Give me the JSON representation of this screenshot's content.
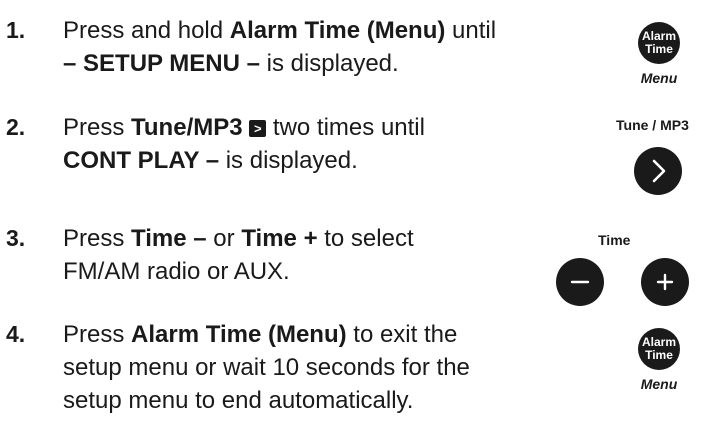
{
  "steps": [
    {
      "num": "1.",
      "parts": [
        "Press and hold ",
        "Alarm Time (Menu)",
        " until",
        "– SETUP MENU –",
        " is displayed."
      ]
    },
    {
      "num": "2.",
      "parts": [
        "Press ",
        "Tune/MP3",
        " two times until",
        "CONT PLAY –",
        " is displayed."
      ],
      "inline_icon": ">"
    },
    {
      "num": "3.",
      "parts": [
        "Press ",
        "Time –",
        " or ",
        "Time +",
        " to select",
        "FM/AM radio or AUX."
      ]
    },
    {
      "num": "4.",
      "parts": [
        "Press ",
        "Alarm Time (Menu)",
        " to exit the",
        "setup menu or wait 10 seconds for the",
        "setup menu to end automatically."
      ]
    }
  ],
  "buttons": {
    "alarm_time_1": {
      "line1": "Alarm",
      "line2": "Time",
      "caption": "Menu"
    },
    "tune_mp3": {
      "caption": "Tune / MP3",
      "symbol": ">"
    },
    "time": {
      "caption": "Time",
      "minus": "–",
      "plus": "+"
    },
    "alarm_time_2": {
      "line1": "Alarm",
      "line2": "Time",
      "caption": "Menu"
    }
  },
  "icons": {
    "alarm_time_button": "alarm-time-button-icon",
    "tune_mp3_button": "tune-mp3-next-button-icon",
    "time_minus_button": "minus-button-icon",
    "time_plus_button": "plus-button-icon"
  },
  "colors": {
    "text": "#1a1a1a",
    "button_fill": "#1a1a1a",
    "button_text": "#ffffff"
  }
}
